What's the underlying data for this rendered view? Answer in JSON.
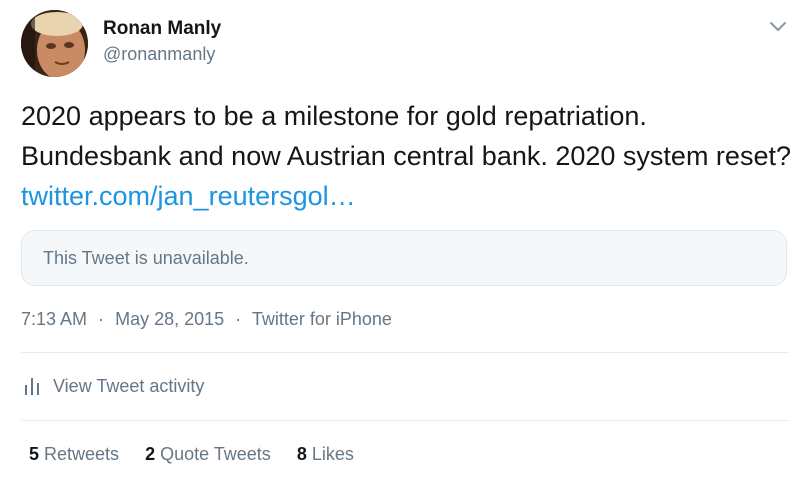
{
  "author": {
    "display_name": "Ronan Manly",
    "handle": "@ronanmanly"
  },
  "tweet": {
    "text": "2020 appears to be a milestone for gold repatriation. Bundesbank and now Austrian central bank. 2020 system reset?",
    "link_text": "twitter.com/jan_reutersgol…"
  },
  "quoted": {
    "unavailable_text": "This Tweet is unavailable."
  },
  "meta": {
    "time": "7:13 AM",
    "separator": "·",
    "date": "May 28, 2015",
    "source": "Twitter for iPhone"
  },
  "activity": {
    "label": "View Tweet activity"
  },
  "stats": {
    "retweets_count": "5",
    "retweets_label": "Retweets",
    "quote_count": "2",
    "quote_label": "Quote Tweets",
    "likes_count": "8",
    "likes_label": "Likes"
  },
  "colors": {
    "link": "#1b95e0",
    "secondary_text": "#657786",
    "primary_text": "#14171a",
    "quote_bg": "#f5f8fa",
    "border": "#e1e8ed"
  },
  "icons": {
    "caret": "chevron-down-icon",
    "activity": "bar-chart-icon"
  }
}
